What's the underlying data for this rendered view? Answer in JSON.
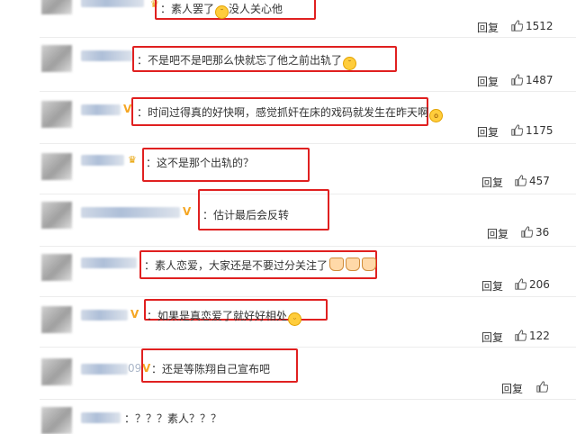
{
  "comments": [
    {
      "text": "素人罢了",
      "suffix": "没人关心他",
      "reply": "回复",
      "likes": "1512"
    },
    {
      "text": "不是吧不是吧那么快就忘了他之前出轨了",
      "reply": "回复",
      "likes": "1487"
    },
    {
      "text": "时间过得真的好快啊，感觉抓奸在床的戏码就发生在昨天啊",
      "reply": "回复",
      "likes": "1175"
    },
    {
      "text": "这不是那个出轨的？",
      "reply": "回复",
      "likes": "457"
    },
    {
      "text": "估计最后会反转",
      "reply": "回复",
      "likes": "36"
    },
    {
      "text": "素人恋爱，大家还是不要过分关注了",
      "reply": "回复",
      "likes": "206"
    },
    {
      "text": "如果是真恋爱了就好好相处",
      "reply": "回复",
      "likes": "122"
    },
    {
      "text": "还是等陈翔自己宣布吧",
      "reply": "回复",
      "likes": ""
    },
    {
      "text": "？？？素人？？？"
    }
  ],
  "colon": "：",
  "partial_name_suffix": "09",
  "highlight_color": "#e02020",
  "like_icon": "thumbs-up-icon",
  "vip_badge": "V"
}
